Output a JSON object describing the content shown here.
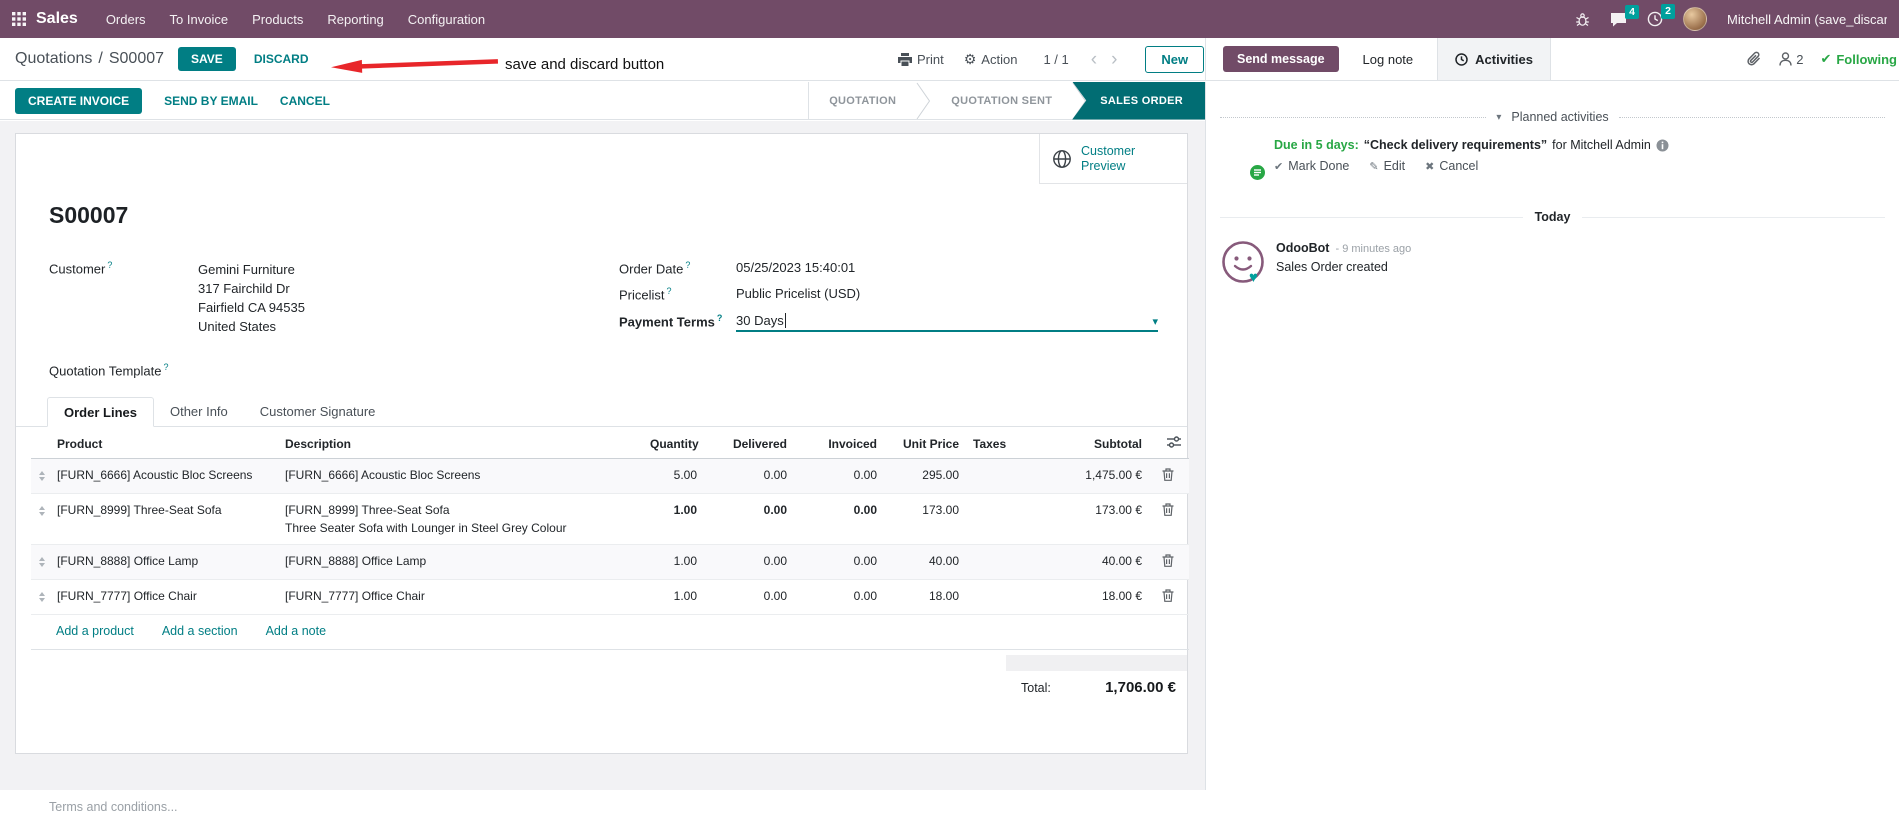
{
  "icons": {
    "caret_down": "▾",
    "chevron_left": "‹",
    "chevron_right": "›",
    "gear": "⚙",
    "check": "✔",
    "pencil": "✎",
    "cross": "✖",
    "question": "?"
  },
  "colors": {
    "primary": "#017E84",
    "purple": "#714B67",
    "success": "#28a745",
    "info": "#17a2b8",
    "badge": "#00A09D"
  },
  "nav": {
    "app_name": "Sales",
    "items": [
      "Orders",
      "To Invoice",
      "Products",
      "Reporting",
      "Configuration"
    ],
    "messages_badge": "4",
    "activities_badge": "2",
    "user_name": "Mitchell Admin (save_discar"
  },
  "control": {
    "breadcrumb_parent": "Quotations",
    "breadcrumb_separator": "/",
    "breadcrumb_current": "S00007",
    "save_label": "SAVE",
    "discard_label": "DISCARD",
    "annotation": "save and discard button",
    "print_label": "Print",
    "action_label": "Action",
    "pager": "1 / 1",
    "new_label": "New"
  },
  "status": {
    "create_invoice": "CREATE INVOICE",
    "send_by_email": "SEND BY EMAIL",
    "cancel": "CANCEL",
    "steps": [
      "QUOTATION",
      "QUOTATION SENT",
      "SALES ORDER"
    ],
    "active_step": "SALES ORDER"
  },
  "sheet": {
    "customer_preview": "Customer Preview",
    "title": "S00007",
    "fields": {
      "customer_label": "Customer",
      "customer_name": "Gemini Furniture",
      "address_line1": "317 Fairchild Dr",
      "address_line2": "Fairfield CA 94535",
      "address_line3": "United States",
      "quotation_template_label": "Quotation Template",
      "order_date_label": "Order Date",
      "order_date_value": "05/25/2023 15:40:01",
      "pricelist_label": "Pricelist",
      "pricelist_value": "Public Pricelist (USD)",
      "payment_terms_label": "Payment Terms",
      "payment_terms_value": "30 Days"
    },
    "tabs": [
      "Order Lines",
      "Other Info",
      "Customer Signature"
    ],
    "table": {
      "headers": {
        "product": "Product",
        "description": "Description",
        "quantity": "Quantity",
        "delivered": "Delivered",
        "invoiced": "Invoiced",
        "unit_price": "Unit Price",
        "taxes": "Taxes",
        "subtotal": "Subtotal"
      },
      "rows": [
        {
          "product": "[FURN_6666] Acoustic Bloc Screens",
          "description": "[FURN_6666] Acoustic Bloc Screens",
          "description2": "",
          "quantity": "5.00",
          "delivered": "0.00",
          "invoiced": "0.00",
          "unit_price": "295.00",
          "taxes": "",
          "subtotal": "1,475.00 €"
        },
        {
          "product": "[FURN_8999] Three-Seat Sofa",
          "description": "[FURN_8999] Three-Seat Sofa",
          "description2": "Three Seater Sofa with Lounger in Steel Grey Colour",
          "quantity": "1.00",
          "delivered": "0.00",
          "invoiced": "0.00",
          "unit_price": "173.00",
          "taxes": "",
          "subtotal": "173.00 €"
        },
        {
          "product": "[FURN_8888] Office Lamp",
          "description": "[FURN_8888] Office Lamp",
          "description2": "",
          "quantity": "1.00",
          "delivered": "0.00",
          "invoiced": "0.00",
          "unit_price": "40.00",
          "taxes": "",
          "subtotal": "40.00 €"
        },
        {
          "product": "[FURN_7777] Office Chair",
          "description": "[FURN_7777] Office Chair",
          "description2": "",
          "quantity": "1.00",
          "delivered": "0.00",
          "invoiced": "0.00",
          "unit_price": "18.00",
          "taxes": "",
          "subtotal": "18.00 €"
        }
      ],
      "add_product": "Add a product",
      "add_section": "Add a section",
      "add_note": "Add a note"
    },
    "terms_placeholder": "Terms and conditions...",
    "total_label": "Total:",
    "total_value": "1,706.00 €"
  },
  "chatter": {
    "send_message": "Send message",
    "log_note": "Log note",
    "activities": "Activities",
    "followers_count": "2",
    "following": "Following",
    "planned_header": "Planned activities",
    "activity": {
      "due": "Due in 5 days:",
      "summary": "“Check delivery requirements”",
      "assignee": "for Mitchell Admin",
      "mark_done": "Mark Done",
      "edit": "Edit",
      "cancel": "Cancel"
    },
    "today": "Today",
    "message": {
      "author": "OdooBot",
      "time": "- 9 minutes ago",
      "body": "Sales Order created"
    }
  }
}
